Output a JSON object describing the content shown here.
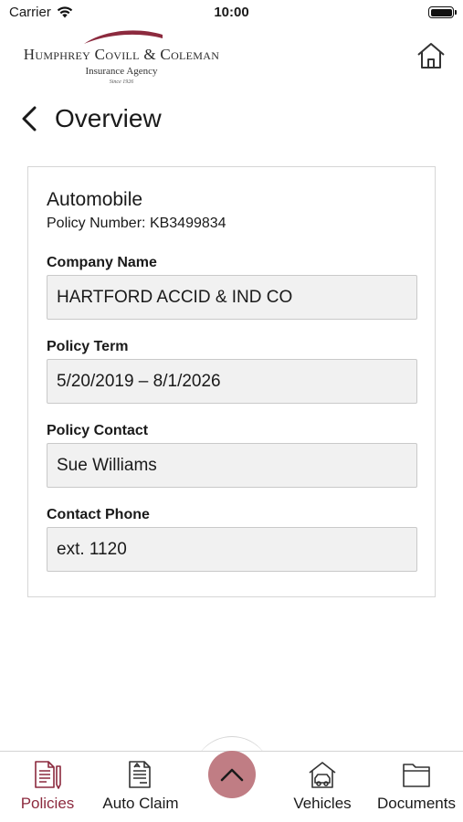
{
  "status_bar": {
    "carrier": "Carrier",
    "time": "10:00"
  },
  "header": {
    "brand_name": "Humphrey Covill & Coleman",
    "brand_sub": "Insurance Agency",
    "brand_since": "Since 1926",
    "home_icon": "home-icon"
  },
  "page": {
    "title": "Overview",
    "back_icon": "chevron-left-icon"
  },
  "policy": {
    "type": "Automobile",
    "number_label": "Policy Number:",
    "number": "KB3499834",
    "fields": [
      {
        "label": "Company Name",
        "value": "HARTFORD ACCID & IND CO"
      },
      {
        "label": "Policy Term",
        "value": "5/20/2019 – 8/1/2026"
      },
      {
        "label": "Policy Contact",
        "value": "Sue Williams"
      },
      {
        "label": "Contact Phone",
        "value": "ext. 1120"
      }
    ]
  },
  "tab_bar": {
    "tabs": [
      {
        "label": "Policies",
        "icon": "policies-icon",
        "active": true
      },
      {
        "label": "Auto Claim",
        "icon": "auto-claim-icon",
        "active": false
      },
      {
        "label": "Vehicles",
        "icon": "vehicles-icon",
        "active": false
      },
      {
        "label": "Documents",
        "icon": "documents-icon",
        "active": false
      }
    ],
    "center_button_icon": "chevron-up-icon"
  },
  "colors": {
    "brand": "#8c2a3e",
    "fab": "#c07d84",
    "field_bg": "#f1f1f1"
  }
}
